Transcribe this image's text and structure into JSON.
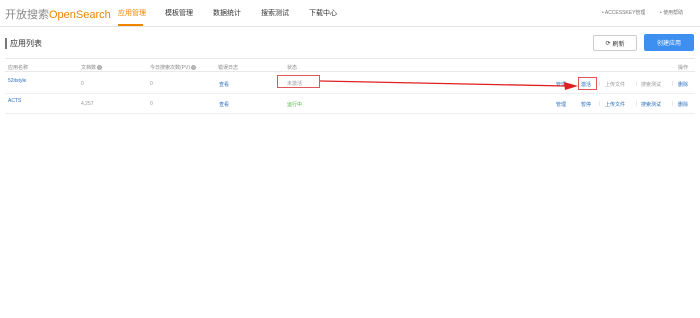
{
  "brand": {
    "prefix": "开放搜索",
    "name": "OpenSearch"
  },
  "nav": {
    "tabs": [
      {
        "label": "应用管理",
        "active": true
      },
      {
        "label": "模板管理",
        "active": false
      },
      {
        "label": "数据统计",
        "active": false
      },
      {
        "label": "搜索测试",
        "active": false
      },
      {
        "label": "下载中心",
        "active": false
      }
    ],
    "accesskey_link": "• ACCESSKEY管理",
    "help_link": "• 使用帮助"
  },
  "page": {
    "title": "应用列表",
    "refresh_label": "刷新",
    "create_label": "创建应用"
  },
  "table": {
    "headers": {
      "name": "应用名称",
      "docs": "文档数",
      "pv": "今日搜索次数(PV)",
      "error_log": "错误日志",
      "status": "状态",
      "actions": "操作"
    },
    "help_glyph": "?",
    "rows": [
      {
        "name": "52itstyle",
        "docs": "0",
        "pv": "0",
        "error_log": "查看",
        "status": "未激活",
        "actions": [
          "管理",
          "激活",
          "上传文件",
          "搜索测试",
          "删除"
        ]
      },
      {
        "name": "ACTS",
        "docs": "4,257",
        "pv": "0",
        "error_log": "查看",
        "status": "运行中",
        "actions": [
          "管理",
          "暂停",
          "上传文件",
          "搜索测试",
          "删除"
        ]
      }
    ]
  },
  "colors": {
    "accent": "#f08300",
    "primary_button": "#3d8ff0",
    "link": "#2d6fbf",
    "running": "#4bb33b",
    "annotation": "#e02020"
  }
}
